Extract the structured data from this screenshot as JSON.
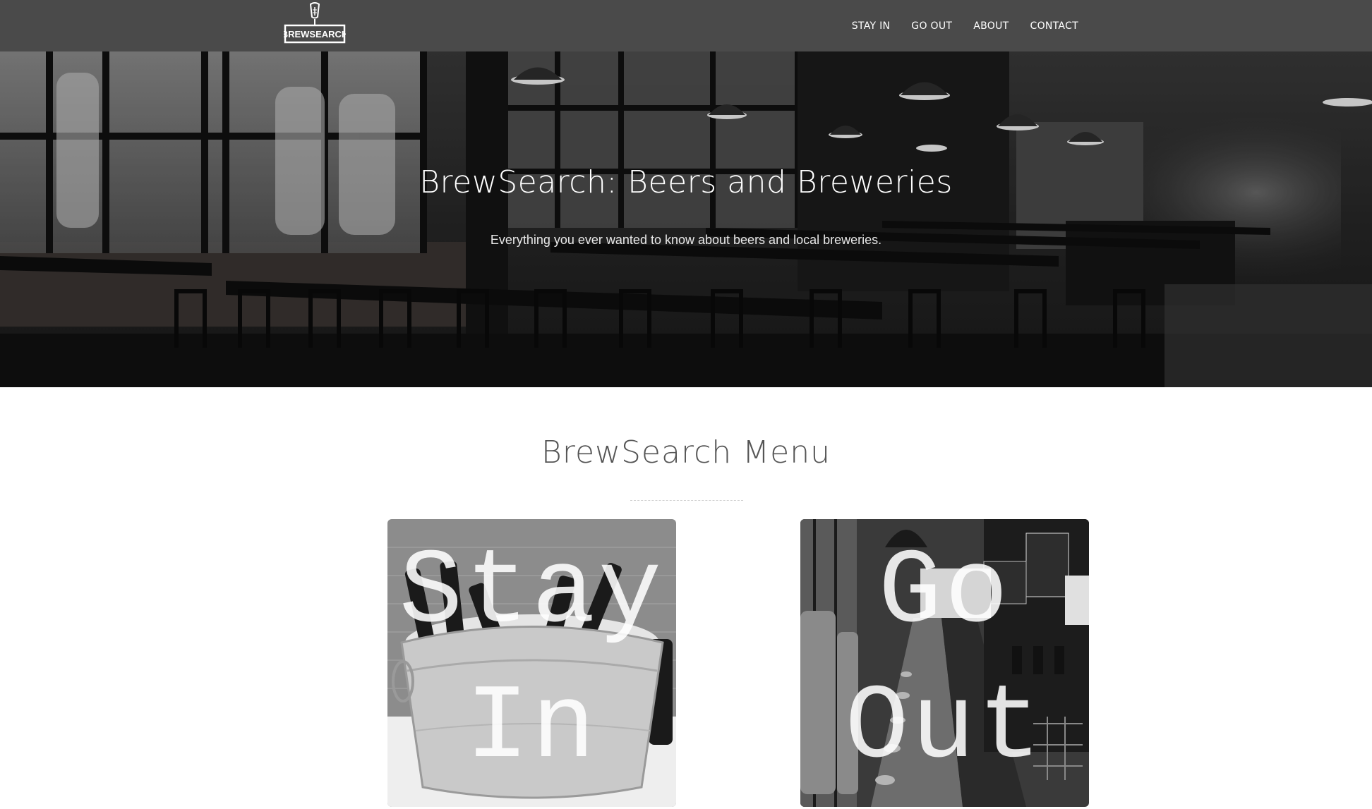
{
  "brand": {
    "logo_text": "BREWSEARCH"
  },
  "nav": {
    "items": [
      {
        "label": "STAY IN"
      },
      {
        "label": "GO OUT"
      },
      {
        "label": "ABOUT"
      },
      {
        "label": "CONTACT"
      }
    ]
  },
  "hero": {
    "title": "BrewSearch: Beers and Breweries",
    "subtitle": "Everything you ever wanted to know about beers and local breweries."
  },
  "menu": {
    "title": "BrewSearch Menu",
    "cards": [
      {
        "line1": "Stay",
        "line2": "In"
      },
      {
        "line1": "Go",
        "line2": "Out"
      }
    ]
  },
  "colors": {
    "navbar": "#4a4a4a",
    "text_heading": "#555555"
  }
}
